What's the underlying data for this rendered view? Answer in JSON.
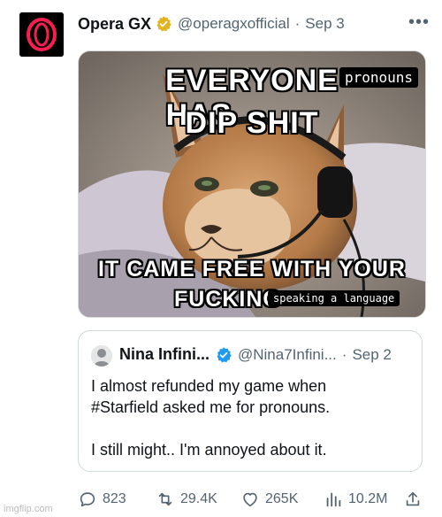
{
  "tweet": {
    "author_name": "Opera GX",
    "handle": "@operagxofficial",
    "separator": "·",
    "date": "Sep 3",
    "more_label": "•••",
    "verified_color": "#e3b422",
    "avatar_icon": "opera-logo",
    "brand_color": "#fa1e4e"
  },
  "meme": {
    "top_line_1": "EVERYONE HAS",
    "censor_top": "pronouns",
    "top_line_2": "DIP SHIT",
    "bottom_line_1": "IT CAME FREE WITH YOUR",
    "bottom_line_2": "FUCKING",
    "censor_bottom": "speaking a language"
  },
  "quote": {
    "author_name": "Nina Infini...",
    "handle": "@Nina7Infini...",
    "separator": "·",
    "date": "Sep 2",
    "verified_color": "#1d9bf0",
    "text_line_1": "I almost refunded my game when",
    "text_line_2": "#Starfield asked me for pronouns.",
    "text_line_3": "I still might.. I'm annoyed about it."
  },
  "actions": {
    "replies": "823",
    "retweets": "29.4K",
    "likes": "265K",
    "views": "10.2M"
  },
  "watermark": "imgflip.com"
}
